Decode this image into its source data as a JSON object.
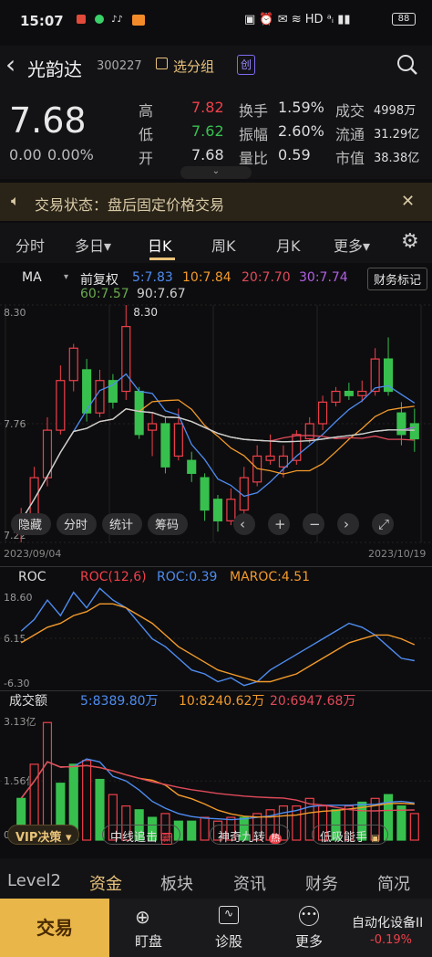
{
  "status": {
    "time": "15:07",
    "battery": "88"
  },
  "header": {
    "back": "‹",
    "name": "光韵达",
    "code": "300227",
    "watch": "选分组",
    "tag": "创"
  },
  "quote": {
    "price": "7.68",
    "change": "0.00",
    "pct": "0.00%",
    "rows": [
      [
        "高",
        "7.82",
        "换手",
        "1.59%",
        "成交",
        "4998万"
      ],
      [
        "低",
        "7.62",
        "振幅",
        "2.60%",
        "流通",
        "31.29亿"
      ],
      [
        "开",
        "7.68",
        "量比",
        "0.59",
        "市值",
        "38.38亿"
      ]
    ]
  },
  "banner": {
    "text": "交易状态：盘后固定价格交易",
    "close": "✕"
  },
  "tabs": [
    "分时",
    "多日▾",
    "日K",
    "周K",
    "月K",
    "更多▾"
  ],
  "ma": {
    "label": "MA",
    "fq": "前复权",
    "items": [
      "5:7.83",
      "10:7.84",
      "20:7.70",
      "30:7.74"
    ],
    "items2": [
      "60:7.57",
      "90:7.67"
    ],
    "tag": "财务标记",
    "colors": [
      "#4e8cf0",
      "#f39a2b",
      "#e04a5a",
      "#b060e0",
      "#6aa84f",
      "#cfcfcf"
    ]
  },
  "chart_data": {
    "type": "candlestick",
    "ylim": [
      7.2,
      8.3
    ],
    "yticks": [
      "8.30",
      "7.76",
      "7.22"
    ],
    "xlabels": [
      "2023/09/04",
      "2023/10/19"
    ],
    "peak_label": "8.30",
    "candles": [
      [
        7.24,
        7.3,
        7.36,
        7.2
      ],
      [
        7.3,
        7.5,
        7.55,
        7.28
      ],
      [
        7.5,
        7.72,
        7.78,
        7.46
      ],
      [
        7.72,
        7.95,
        8.02,
        7.7
      ],
      [
        7.95,
        8.1,
        8.12,
        7.9
      ],
      [
        8.0,
        7.8,
        8.05,
        7.76
      ],
      [
        7.8,
        7.95,
        8.0,
        7.78
      ],
      [
        7.95,
        7.85,
        7.98,
        7.82
      ],
      [
        7.9,
        8.2,
        8.3,
        7.86
      ],
      [
        7.9,
        7.7,
        7.92,
        7.68
      ],
      [
        7.72,
        7.75,
        7.8,
        7.6
      ],
      [
        7.75,
        7.55,
        7.78,
        7.52
      ],
      [
        7.6,
        7.75,
        7.82,
        7.58
      ],
      [
        7.58,
        7.52,
        7.62,
        7.48
      ],
      [
        7.5,
        7.35,
        7.52,
        7.3
      ],
      [
        7.4,
        7.3,
        7.42,
        7.25
      ],
      [
        7.3,
        7.4,
        7.45,
        7.28
      ],
      [
        7.35,
        7.5,
        7.55,
        7.33
      ],
      [
        7.48,
        7.6,
        7.65,
        7.46
      ],
      [
        7.58,
        7.6,
        7.7,
        7.56
      ],
      [
        7.55,
        7.6,
        7.65,
        7.5
      ],
      [
        7.58,
        7.7,
        7.72,
        7.56
      ],
      [
        7.68,
        7.75,
        7.78,
        7.66
      ],
      [
        7.75,
        7.85,
        7.88,
        7.72
      ],
      [
        7.85,
        7.9,
        7.92,
        7.83
      ],
      [
        7.9,
        7.88,
        7.94,
        7.86
      ],
      [
        7.88,
        7.9,
        7.95,
        7.85
      ],
      [
        7.9,
        8.05,
        8.1,
        7.88
      ],
      [
        8.05,
        7.9,
        8.15,
        7.88
      ],
      [
        7.8,
        7.7,
        7.85,
        7.65
      ],
      [
        7.75,
        7.68,
        7.82,
        7.62
      ]
    ],
    "macd_tools": [
      "隐藏",
      "分时",
      "统计",
      "筹码"
    ]
  },
  "roc": {
    "label": "ROC",
    "a": "ROC(12,6)",
    "b": "ROC:0.39",
    "c": "MAROC:4.51",
    "yticks": [
      "18.60",
      "6.15",
      "-6.30"
    ],
    "roc": [
      8,
      11,
      16,
      12,
      18,
      14,
      19,
      16,
      14,
      10,
      6,
      4,
      1,
      -2,
      -3,
      -5,
      -4,
      -6,
      -5,
      -2,
      0,
      2,
      4,
      6,
      8,
      10,
      9,
      7,
      4,
      1,
      0.39
    ],
    "maroc": [
      5,
      7,
      9,
      10,
      12,
      13,
      15,
      15,
      14,
      12,
      10,
      7,
      4,
      2,
      0,
      -2,
      -3,
      -4,
      -5,
      -5,
      -4,
      -3,
      -1,
      1,
      3,
      5,
      6,
      7,
      7,
      6,
      4.51
    ]
  },
  "vol": {
    "label": "成交额",
    "a": "5:8389.80万",
    "b": "10:8240.62万",
    "c": "20:6947.68万",
    "yticks": [
      "3.13亿",
      "1.56亿",
      "0.00"
    ],
    "bars": [
      [
        1.1,
        0
      ],
      [
        2.0,
        1
      ],
      [
        3.1,
        1
      ],
      [
        1.5,
        0
      ],
      [
        2.0,
        0
      ],
      [
        2.1,
        1
      ],
      [
        1.6,
        0
      ],
      [
        1.2,
        1
      ],
      [
        0.9,
        1
      ],
      [
        0.8,
        0
      ],
      [
        0.6,
        0
      ],
      [
        0.7,
        1
      ],
      [
        0.5,
        0
      ],
      [
        0.5,
        0
      ],
      [
        0.6,
        1
      ],
      [
        0.5,
        1
      ],
      [
        0.6,
        1
      ],
      [
        0.6,
        0
      ],
      [
        0.7,
        1
      ],
      [
        0.8,
        1
      ],
      [
        0.9,
        1
      ],
      [
        0.9,
        1
      ],
      [
        1.1,
        1
      ],
      [
        0.9,
        1
      ],
      [
        0.8,
        0
      ],
      [
        0.9,
        1
      ],
      [
        1.0,
        0
      ],
      [
        1.1,
        1
      ],
      [
        1.2,
        0
      ],
      [
        0.9,
        0
      ],
      [
        0.7,
        1
      ]
    ]
  },
  "pills": [
    "VIP决策 ▾",
    "中线追击",
    "神奇九转",
    "低吸能手"
  ],
  "nav": [
    "Level2",
    "资金",
    "板块",
    "资讯",
    "财务",
    "简况"
  ],
  "actions": {
    "trade": "交易",
    "items": [
      "盯盘",
      "诊股",
      "更多"
    ],
    "sector": "自动化设备II",
    "sector_pct": "-0.19%"
  }
}
